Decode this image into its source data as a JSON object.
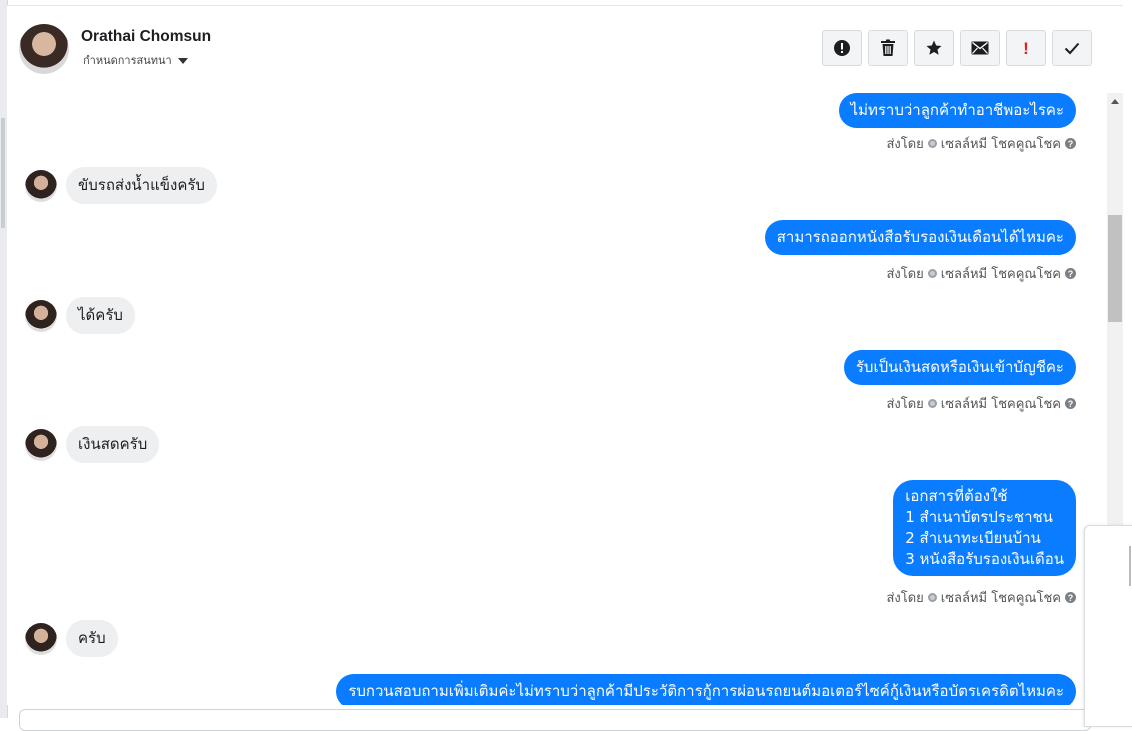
{
  "header": {
    "contact_name": "Orathai Chomsun",
    "conversation_setting": "กำหนดการสนทนา"
  },
  "toolbar": {
    "buttons": [
      {
        "name": "report",
        "icon": "alert-circle-icon"
      },
      {
        "name": "delete",
        "icon": "trash-icon"
      },
      {
        "name": "star",
        "icon": "star-icon"
      },
      {
        "name": "mark-unread",
        "icon": "envelope-icon"
      },
      {
        "name": "important",
        "icon": "exclamation-icon",
        "label": "!"
      },
      {
        "name": "done",
        "icon": "check-icon"
      }
    ]
  },
  "sent_by": {
    "prefix": "ส่งโดย",
    "agent": "เซลล์หมี โชคคูณโชค"
  },
  "messages": [
    {
      "direction": "out",
      "text": "ไม่ทราบว่าลูกค้าทำอาชีพอะไรคะ"
    },
    {
      "direction": "in",
      "text": "ขับรถส่งน้ำแข็งครับ"
    },
    {
      "direction": "out",
      "text": "สามารถออกหนังสือรับรองเงินเดือนได้ไหมคะ"
    },
    {
      "direction": "in",
      "text": "ได้ครับ"
    },
    {
      "direction": "out",
      "text": "รับเป็นเงินสดหรือเงินเข้าบัญชีคะ"
    },
    {
      "direction": "in",
      "text": "เงินสดครับ"
    },
    {
      "direction": "out",
      "lines": [
        "เอกสารที่ต้องใช้",
        "1 สำเนาบัตรประชาชน",
        "2 สำเนาทะเบียนบ้าน",
        "3 หนังสือรับรองเงินเดือน"
      ]
    },
    {
      "direction": "in",
      "text": "ครับ"
    },
    {
      "direction": "out",
      "text": "รบกวนสอบถามเพิ่มเติมค่ะไม่ทราบว่าลูกค้ามีประวัติการกู้การผ่อนรถยนต์มอเตอร์ไซค์กู้เงินหรือบัตรเครดิตไหมคะ"
    }
  ],
  "colors": {
    "outgoing_bubble": "#0a7cff",
    "incoming_bubble": "#eeeff1",
    "important_icon": "#e02020"
  }
}
